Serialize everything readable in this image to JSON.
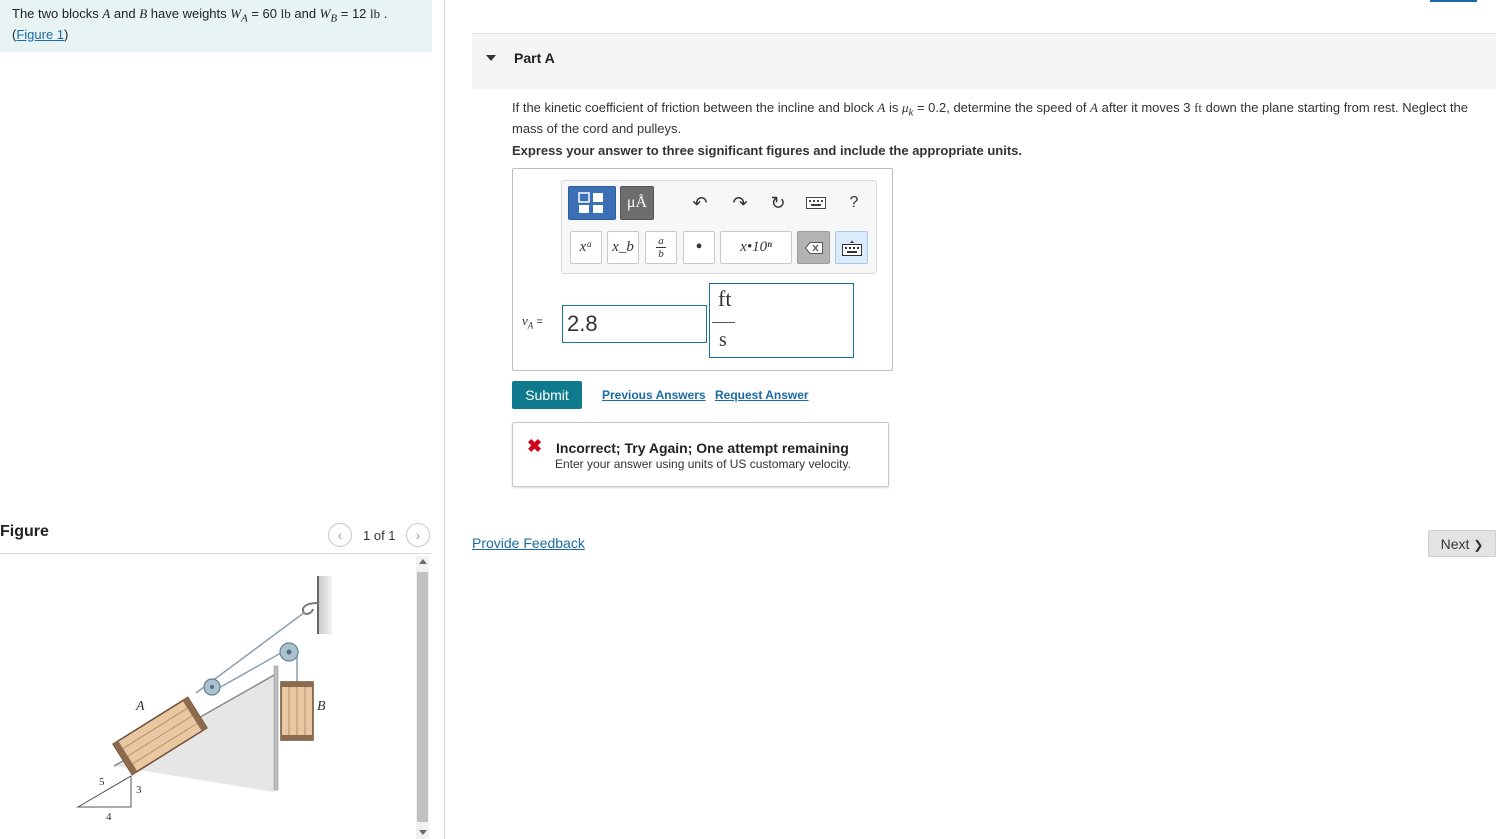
{
  "problem": {
    "text_pre": "The two blocks ",
    "block_a": "A",
    "text_and1": " and ",
    "block_b": "B",
    "text_have": " have weights ",
    "wa_var": "W",
    "wa_sub": "A",
    "wa_value": " = 60 ",
    "wa_unit": "lb",
    "text_and2": " and ",
    "wb_var": "W",
    "wb_sub": "B",
    "wb_value": " = 12 ",
    "wb_unit": "lb",
    "text_end": " .",
    "figure_link_open": "(",
    "figure_link": "Figure 1",
    "figure_link_close": ")"
  },
  "figure": {
    "title": "Figure",
    "count": "1 of 1",
    "prev_glyph": "‹",
    "next_glyph": "›",
    "labels": {
      "a": "A",
      "b": "B",
      "s5": "5",
      "s3": "3",
      "s4": "4"
    }
  },
  "part": {
    "title": "Part A",
    "q_pre": "If the kinetic coefficient of friction between the incline and block ",
    "q_a": "A",
    "q_is": " is ",
    "q_mu": "μ",
    "q_mu_sub": "k",
    "q_mu_val": " = 0.2, determine the speed of ",
    "q_a2": "A",
    "q_after": " after it moves 3 ",
    "q_ft": "ft",
    "q_end": " down the plane starting from rest. Neglect the mass of the cord and pulleys.",
    "instruction": "Express your answer to three significant figures and include the appropriate units."
  },
  "toolbar": {
    "units_label": "μÅ",
    "undo": "↶",
    "redo": "↷",
    "reset": "↻",
    "help": "?",
    "sup_label": "xᵃ",
    "sub_label": "x_b",
    "frac_num": "a",
    "frac_den": "b",
    "dot": "•",
    "sci_label": "x•10ⁿ"
  },
  "answer": {
    "var_label": "v",
    "var_sub": "A",
    "equals": " =",
    "value": "2.8",
    "unit_num": "ft",
    "unit_den": "s"
  },
  "actions": {
    "submit": "Submit",
    "previous_answers": "Previous Answers",
    "request_answer": "Request Answer"
  },
  "feedback": {
    "icon": "✖",
    "title": "Incorrect; Try Again; One attempt remaining",
    "message": "Enter your answer using units of US customary velocity."
  },
  "footer": {
    "provide_feedback": "Provide Feedback",
    "next": "Next",
    "next_glyph": "❯"
  },
  "colors": {
    "accent": "#0f7a8c",
    "link": "#1b6aa5",
    "error": "#d0021b",
    "problem_bg": "#e8f4f4"
  }
}
